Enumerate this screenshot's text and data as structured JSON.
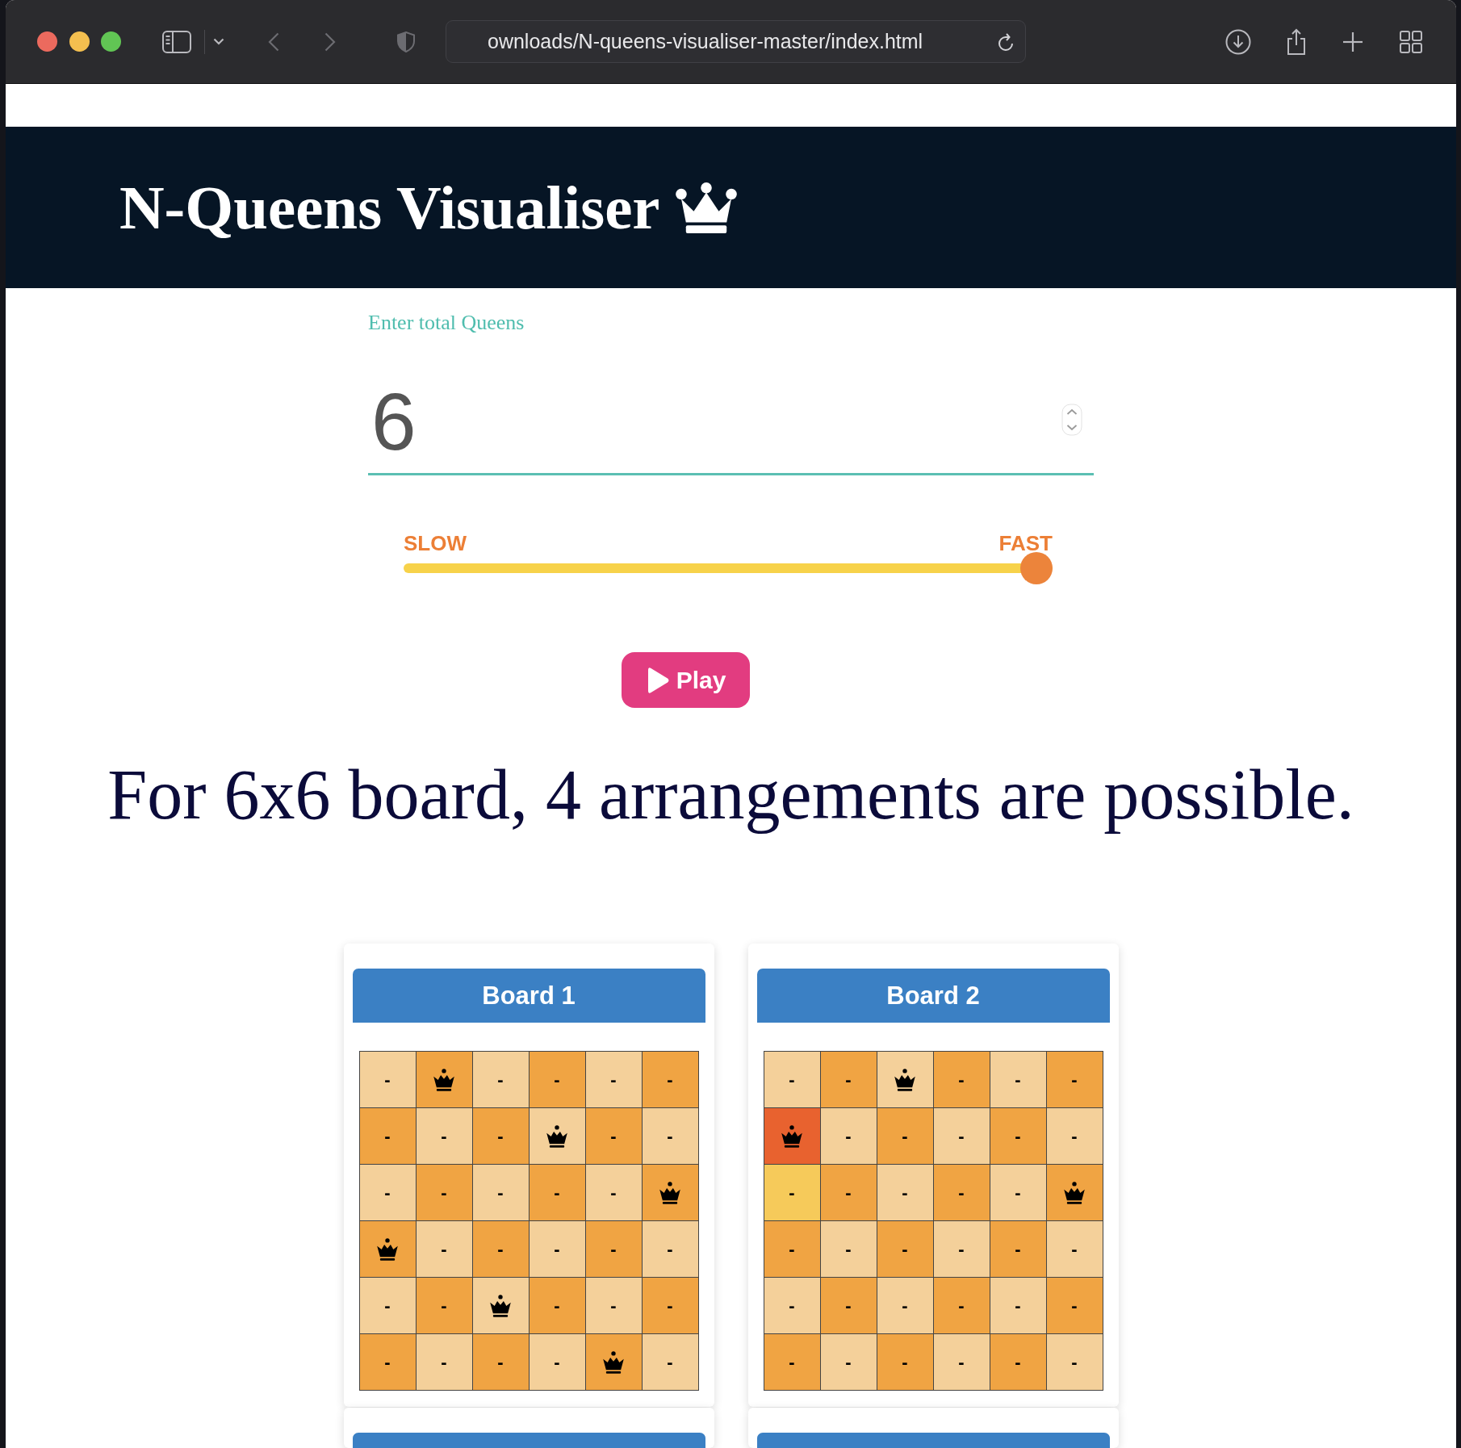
{
  "browser": {
    "url": "ownloads/N-queens-visualiser-master/index.html"
  },
  "header": {
    "title": "N-Queens Visualiser"
  },
  "queens_input": {
    "label": "Enter total Queens",
    "value": "6"
  },
  "speed_slider": {
    "min_label": "SLOW",
    "max_label": "FAST",
    "level": 1
  },
  "play_button": {
    "label": "Play"
  },
  "result": {
    "text": "For 6x6 board, 4 arrangements are possible."
  },
  "boards": [
    {
      "kind": "full",
      "title": "Board 1",
      "rows": [
        [
          {
            "queen": false,
            "text": "-"
          },
          {
            "queen": true
          },
          {
            "queen": false,
            "text": "-"
          },
          {
            "queen": false,
            "text": "-"
          },
          {
            "queen": false,
            "text": "-"
          },
          {
            "queen": false,
            "text": "-"
          }
        ],
        [
          {
            "queen": false,
            "text": "-"
          },
          {
            "queen": false,
            "text": "-"
          },
          {
            "queen": false,
            "text": "-"
          },
          {
            "queen": true
          },
          {
            "queen": false,
            "text": "-"
          },
          {
            "queen": false,
            "text": "-"
          }
        ],
        [
          {
            "queen": false,
            "text": "-"
          },
          {
            "queen": false,
            "text": "-"
          },
          {
            "queen": false,
            "text": "-"
          },
          {
            "queen": false,
            "text": "-"
          },
          {
            "queen": false,
            "text": "-"
          },
          {
            "queen": true
          }
        ],
        [
          {
            "queen": true
          },
          {
            "queen": false,
            "text": "-"
          },
          {
            "queen": false,
            "text": "-"
          },
          {
            "queen": false,
            "text": "-"
          },
          {
            "queen": false,
            "text": "-"
          },
          {
            "queen": false,
            "text": "-"
          }
        ],
        [
          {
            "queen": false,
            "text": "-"
          },
          {
            "queen": false,
            "text": "-"
          },
          {
            "queen": true
          },
          {
            "queen": false,
            "text": "-"
          },
          {
            "queen": false,
            "text": "-"
          },
          {
            "queen": false,
            "text": "-"
          }
        ],
        [
          {
            "queen": false,
            "text": "-"
          },
          {
            "queen": false,
            "text": "-"
          },
          {
            "queen": false,
            "text": "-"
          },
          {
            "queen": false,
            "text": "-"
          },
          {
            "queen": true
          },
          {
            "queen": false,
            "text": "-"
          }
        ]
      ]
    },
    {
      "kind": "full",
      "title": "Board 2",
      "rows": [
        [
          {
            "queen": false,
            "text": "-"
          },
          {
            "queen": false,
            "text": "-"
          },
          {
            "queen": true
          },
          {
            "queen": false,
            "text": "-"
          },
          {
            "queen": false,
            "text": "-"
          },
          {
            "queen": false,
            "text": "-"
          }
        ],
        [
          {
            "queen": true,
            "color": "#e8622f"
          },
          {
            "queen": false,
            "text": "-"
          },
          {
            "queen": false,
            "text": "-"
          },
          {
            "queen": false,
            "text": "-"
          },
          {
            "queen": false,
            "text": "-"
          },
          {
            "queen": false,
            "text": "-"
          }
        ],
        [
          {
            "queen": false,
            "text": "-",
            "color": "#f6ca5a"
          },
          {
            "queen": false,
            "text": "-"
          },
          {
            "queen": false,
            "text": "-"
          },
          {
            "queen": false,
            "text": "-"
          },
          {
            "queen": false,
            "text": "-"
          },
          {
            "queen": true
          }
        ],
        [
          {
            "queen": false,
            "text": "-"
          },
          {
            "queen": false,
            "text": "-"
          },
          {
            "queen": false,
            "text": "-"
          },
          {
            "queen": false,
            "text": "-"
          },
          {
            "queen": false,
            "text": "-"
          },
          {
            "queen": false,
            "text": "-"
          }
        ],
        [
          {
            "queen": false,
            "text": "-"
          },
          {
            "queen": false,
            "text": "-"
          },
          {
            "queen": false,
            "text": "-"
          },
          {
            "queen": false,
            "text": "-"
          },
          {
            "queen": false,
            "text": "-"
          },
          {
            "queen": false,
            "text": "-"
          }
        ],
        [
          {
            "queen": false,
            "text": "-"
          },
          {
            "queen": false,
            "text": "-"
          },
          {
            "queen": false,
            "text": "-"
          },
          {
            "queen": false,
            "text": "-"
          },
          {
            "queen": false,
            "text": "-"
          },
          {
            "queen": false,
            "text": "-"
          }
        ]
      ]
    },
    {
      "kind": "clipped"
    },
    {
      "kind": "clipped"
    }
  ]
}
